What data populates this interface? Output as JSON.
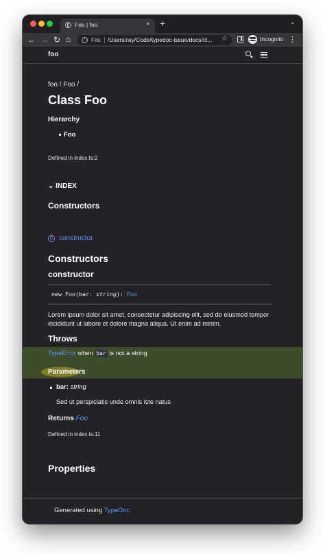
{
  "browser": {
    "tab_title": "Foo | foo",
    "tab_close": "×",
    "new_tab": "+",
    "tab_menu": "⌄",
    "nav_back": "←",
    "nav_forward": "→",
    "nav_reload": "↻",
    "nav_home": "⌂",
    "info_icon": "i",
    "file_label": "File",
    "url": "/Users/ray/Code/typedoc-issue/docs/cl...",
    "star": "☆",
    "profile_label": "Incognito",
    "menu": "⋮",
    "traffic_light_colors": [
      "#fe5f57",
      "#febc2e",
      "#28c840"
    ]
  },
  "site": {
    "title": "foo"
  },
  "page": {
    "breadcrumb": "foo / Foo /",
    "heading": "Class Foo",
    "hierarchy_heading": "Hierarchy",
    "hierarchy_item": "Foo",
    "defined_in": "Defined in index.ts:2",
    "index_chevron": "⌄",
    "index_label": "INDEX",
    "constructors_subheading": "Constructors",
    "constructor_badge": "C",
    "constructor_link": "constructor",
    "constructors_section": "Constructors",
    "constructor_name": "constructor",
    "signature": {
      "prefix": "new Foo(bar: ",
      "param_type": "string",
      "middle": "): ",
      "return_type": "Foo"
    },
    "description": "Lorem ipsum dolor sit amet, consectetur adipiscing elit, sed do eiusmod tempor incididunt ut labore et dolore magna aliqua. Ut enim ad minim.",
    "throws": {
      "heading": "Throws",
      "error_type": "TypeError",
      "when": " when ",
      "code": "bar",
      "rest": " is not a string"
    },
    "parameters_heading": "Parameters",
    "param_name": "bar:",
    "param_type": "string",
    "param_description": "Sed ut perspiciatis unde omnis iste natus",
    "returns_label": "Returns",
    "returns_type": "Foo",
    "defined_in_2": "Defined in index.ts:11",
    "properties_heading": "Properties"
  },
  "footer": {
    "prefix": "Generated using ",
    "link": "TypeDoc"
  },
  "colors": {
    "page_background": "#222228",
    "link": "#5d98ef",
    "throws_band": "#3f4d2c",
    "highlight": "#7f7d2c"
  }
}
